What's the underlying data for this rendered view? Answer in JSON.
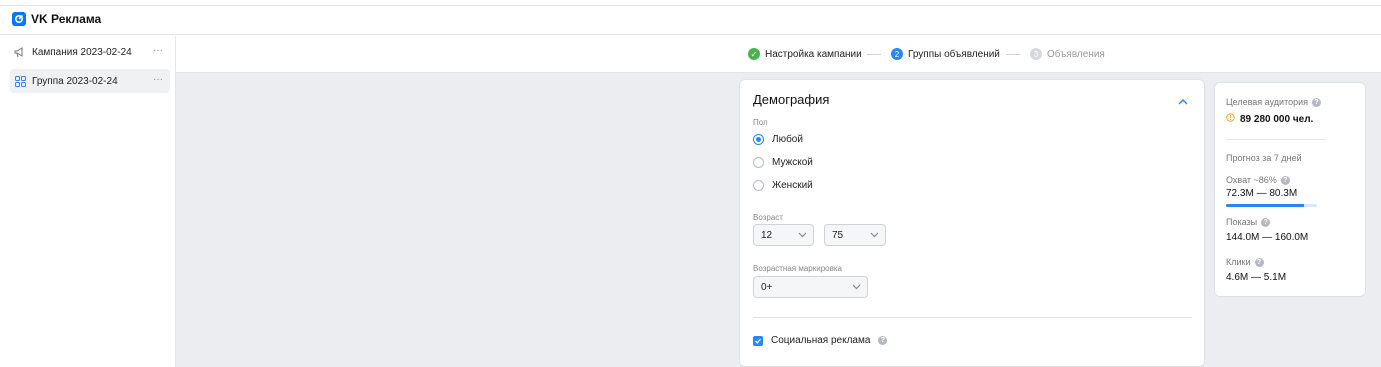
{
  "app": {
    "title": "VK Реклама",
    "accent": "#0077ff"
  },
  "sidebar": {
    "items": [
      {
        "label": "Кампания 2023-02-24",
        "icon": "megaphone-icon",
        "more": "···"
      },
      {
        "label": "Группа 2023-02-24",
        "icon": "grid-icon",
        "more": "···"
      }
    ]
  },
  "stepper": {
    "steps": [
      {
        "label": "Настройка кампании",
        "marker": "✓",
        "state": "done",
        "color": "#4bb34b"
      },
      {
        "label": "Группы объявлений",
        "marker": "2",
        "state": "current",
        "color": "#2787f5"
      },
      {
        "label": "Объявления",
        "marker": "3",
        "state": "upcoming",
        "color": "#c4c8cc"
      }
    ]
  },
  "demography": {
    "title": "Демография",
    "gender": {
      "label": "Пол",
      "options": [
        "Любой",
        "Мужской",
        "Женский"
      ],
      "selected": "Любой"
    },
    "age": {
      "label": "Возраст",
      "from": "12",
      "to": "75"
    },
    "age_marking": {
      "label": "Возрастная маркировка",
      "value": "0+"
    },
    "social_ads": {
      "label": "Социальная реклама",
      "checked": true
    }
  },
  "forecast": {
    "audience_label": "Целевая аудитория",
    "audience_value": "89 280 000 чел.",
    "period_label": "Прогноз за 7 дней",
    "reach_label": "Охват ~86%",
    "reach_value": "72.3M — 80.3M",
    "reach_fraction": 0.86,
    "impressions_label": "Показы",
    "impressions_value": "144.0M — 160.0M",
    "clicks_label": "Клики",
    "clicks_value": "4.6M — 5.1M",
    "warning_color": "#f0a030"
  }
}
